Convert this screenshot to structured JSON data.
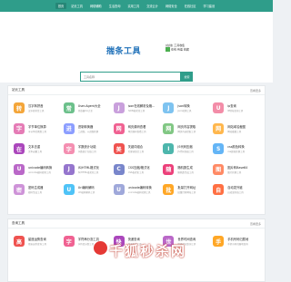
{
  "nav": {
    "items": [
      "首页",
      "站长工具",
      "网络辅助",
      "生活查询",
      "实用工具",
      "交流云计",
      "网络安全",
      "在线社区",
      "学习建设"
    ]
  },
  "hero": {
    "logo": "揣条工具",
    "tool_line1": "[在线] 工具收集",
    "tool_line2": "在线 有着 收藏",
    "search_placeholder": "工具名称",
    "search_button": "搜索"
  },
  "panel1": {
    "title": "站长工具",
    "more": "查看更多",
    "cards": [
      {
        "icon": "转",
        "color": "#f4a63a",
        "title": "汉字转拼音",
        "desc": "汉字转拼音工具"
      },
      {
        "icon": "常",
        "color": "#6cc08b",
        "title": "User-Agent大全",
        "desc": "浏览器UA大全"
      },
      {
        "icon": "J",
        "color": "#c9a0dc",
        "title": "json在线解析及格...",
        "desc": "JSON格式化工具"
      },
      {
        "icon": "J",
        "color": "#7ec3f0",
        "title": "json转换",
        "desc": "json转换工具"
      },
      {
        "icon": "U",
        "color": "#f38da8",
        "title": "ip查询",
        "desc": "IP地址查询工具"
      },
      {
        "icon": "字",
        "color": "#e57cb6",
        "title": "字节单位换算",
        "desc": "字节单位换算工具"
      },
      {
        "icon": "进",
        "color": "#8c9eff",
        "title": "进制转换器",
        "desc": "二进制、十进制转换"
      },
      {
        "icon": "网",
        "color": "#f06292",
        "title": "网页源码查看",
        "desc": "网页源码查看工具"
      },
      {
        "icon": "网",
        "color": "#81c784",
        "title": "网页内容提取",
        "desc": "网页内容提取工具"
      },
      {
        "icon": "网",
        "color": "#ffb74d",
        "title": "网站域名截图",
        "desc": "网站截图工具"
      },
      {
        "icon": "在",
        "color": "#ab47bc",
        "title": "文本去重",
        "desc": "文本去重工具"
      },
      {
        "icon": "字",
        "color": "#f48fb1",
        "title": "字数统计功能",
        "desc": "字数统计在线工具"
      },
      {
        "icon": "美",
        "color": "#ef5350",
        "title": "关键词组合",
        "desc": "关键词组合工具"
      },
      {
        "icon": "I",
        "color": "#4db6ac",
        "title": "JS代码压缩",
        "desc": "JS代码压缩工具"
      },
      {
        "icon": "S",
        "color": "#64b5f6",
        "title": "css颜色转换",
        "desc": "css颜色转换工具"
      },
      {
        "icon": "U",
        "color": "#ba68c8",
        "title": "unicode编码转换",
        "desc": "unicode编码转换工具"
      },
      {
        "icon": "J",
        "color": "#9575cd",
        "title": "JS/HTML格式化",
        "desc": "JS/HTML格式化工具"
      },
      {
        "icon": "C",
        "color": "#7986cb",
        "title": "CSS压缩/格式化",
        "desc": "CSS格式化工具"
      },
      {
        "icon": "随",
        "color": "#ec407a",
        "title": "随机数生成",
        "desc": "随机数生成工具"
      },
      {
        "icon": "图",
        "color": "#ff8a65",
        "title": "图片转Base64",
        "desc": "图片转换工具"
      },
      {
        "icon": "密",
        "color": "#ce93d8",
        "title": "密码生成器",
        "desc": "密码生成工具"
      },
      {
        "icon": "U",
        "color": "#4fc3f7",
        "title": "Url编码解码",
        "desc": "Url编码解码工具"
      },
      {
        "icon": "U",
        "color": "#9fa8da",
        "title": "unicode编码转换",
        "desc": "unicode编码转换工具"
      },
      {
        "icon": "批",
        "color": "#ffa726",
        "title": "批量打开网址",
        "desc": "批量打开网址工具"
      },
      {
        "icon": "自",
        "color": "#ff7043",
        "title": "自动发外链",
        "desc": "自动发外链工具"
      }
    ]
  },
  "panel2": {
    "title": "查询工具",
    "more": "查看更多",
    "cards": [
      {
        "icon": "高",
        "color": "#ef5350",
        "title": "星座运势查询",
        "desc": "星座运势查询工具"
      },
      {
        "icon": "字",
        "color": "#f06292",
        "title": "字符串分割工具",
        "desc": "字符串分割工具"
      },
      {
        "icon": "快",
        "color": "#ab47bc",
        "title": "快递查询",
        "desc": "快递查询工具"
      },
      {
        "icon": "世",
        "color": "#ba68c8",
        "title": "世界时间查询",
        "desc": "世界时间查询工具"
      },
      {
        "icon": "手",
        "color": "#ffa726",
        "title": "手机号码归属地",
        "desc": "手机号码归属地查询"
      }
    ]
  },
  "watermark": "千狐秒杀网"
}
